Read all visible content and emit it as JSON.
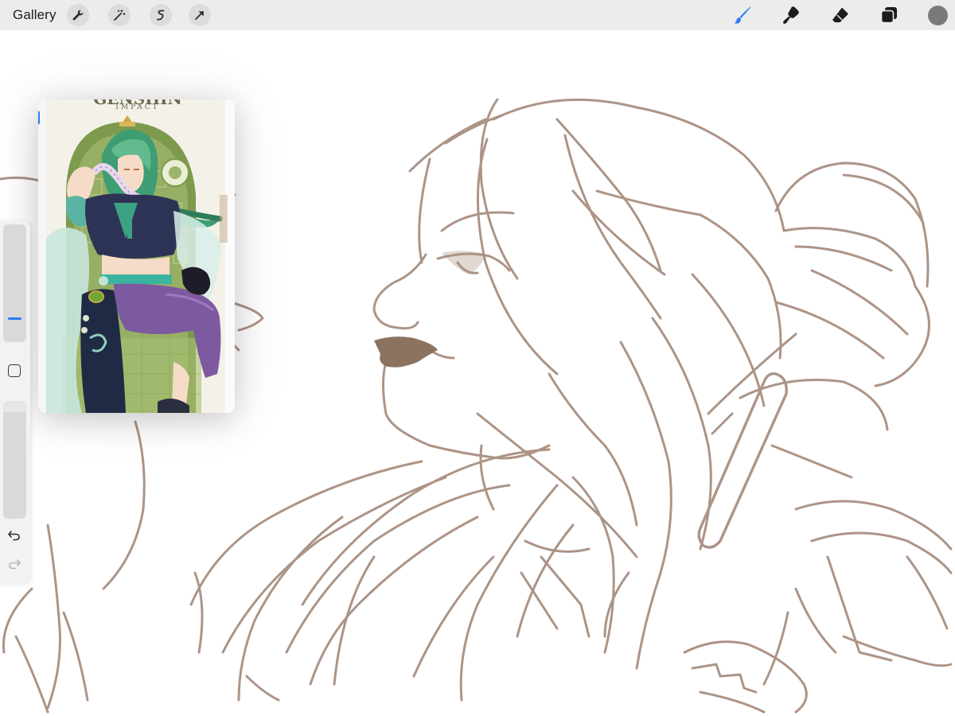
{
  "toolbar": {
    "gallery_label": "Gallery",
    "left_tools": [
      "wrench-icon",
      "magic-wand-icon",
      "selection-icon",
      "transform-arrow-icon"
    ],
    "right_tools": [
      "brush-icon",
      "smudge-icon",
      "eraser-icon",
      "layers-icon"
    ],
    "active_tool": "brush-icon",
    "active_color": "#7a7a7a",
    "accent_color": "#2a7bf6"
  },
  "sidebar": {
    "brush_size": 0.18,
    "opacity": 1.0,
    "controls": [
      "size-slider",
      "modify-button",
      "opacity-slider",
      "undo-icon",
      "redo-icon"
    ]
  },
  "reference": {
    "title_line1": "GENSHIN",
    "title_line2": "IMPACT"
  },
  "canvas": {
    "line_color": "#a88f80",
    "fill_color": "#8c7360"
  }
}
